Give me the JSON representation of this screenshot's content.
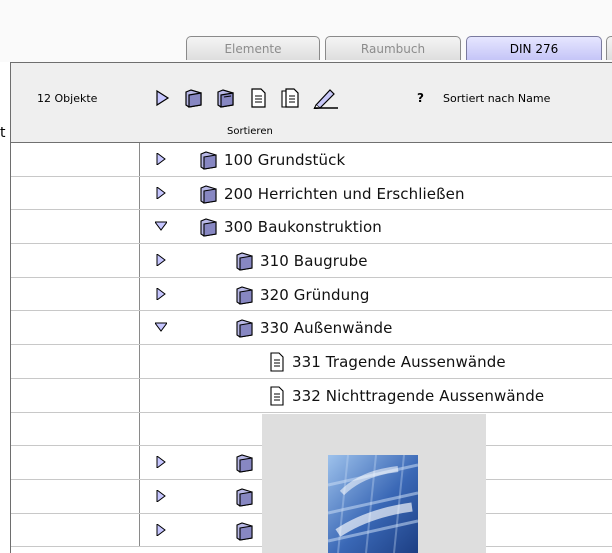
{
  "edge_text": "t",
  "tabs": [
    {
      "label": "Elemente",
      "active": false
    },
    {
      "label": "Raumbuch",
      "active": false
    },
    {
      "label": "DIN 276",
      "active": true
    }
  ],
  "toolbar": {
    "object_count": "12 Objekte",
    "help_label": "?",
    "sort_label": "Sortiert nach Name",
    "icons": [
      "expand-arrow-icon",
      "folder-icon",
      "folder-open-icon",
      "document-icon",
      "documents-icon",
      "pencil-icon"
    ]
  },
  "sort_bar": {
    "label": "Sortieren"
  },
  "tree": [
    {
      "label": "100 Grundstück",
      "state": "collapsed",
      "kind": "folder",
      "level": 0
    },
    {
      "label": "200 Herrichten und Erschließen",
      "state": "collapsed",
      "kind": "folder",
      "level": 0
    },
    {
      "label": "300 Baukonstruktion",
      "state": "expanded",
      "kind": "folder",
      "level": 0
    },
    {
      "label": "310 Baugrube",
      "state": "collapsed",
      "kind": "folder",
      "level": 1
    },
    {
      "label": "320 Gründung",
      "state": "collapsed",
      "kind": "folder",
      "level": 1
    },
    {
      "label": "330 Außenwände",
      "state": "expanded",
      "kind": "folder",
      "level": 1
    },
    {
      "label": "331 Tragende Aussenwände",
      "state": "none",
      "kind": "document",
      "level": 2
    },
    {
      "label": "332 Nichttragende Aussenwände",
      "state": "none",
      "kind": "document",
      "level": 2
    },
    {
      "label": "",
      "state": "none",
      "kind": "none",
      "level": 2
    },
    {
      "label": "",
      "state": "collapsed",
      "kind": "folder",
      "level": 1
    },
    {
      "label": "",
      "state": "collapsed",
      "kind": "folder",
      "level": 1
    },
    {
      "label": "",
      "state": "collapsed",
      "kind": "folder",
      "level": 1
    }
  ],
  "overlay_thumbnail": {
    "icon": "keyboard-photo-thumbnail",
    "colors": [
      "#1d3f84",
      "#9ec2ec"
    ]
  }
}
